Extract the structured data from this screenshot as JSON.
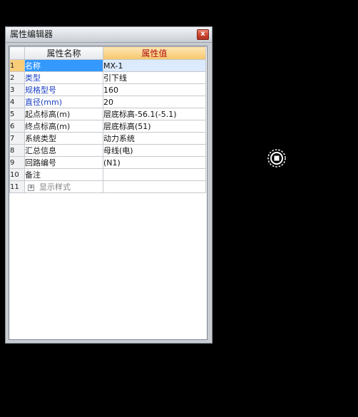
{
  "window": {
    "title": "属性编辑器",
    "close_label": "x"
  },
  "grid": {
    "header_name": "属性名称",
    "header_value": "属性值",
    "rows": [
      {
        "num": "1",
        "name": "名称",
        "value": "MX-1"
      },
      {
        "num": "2",
        "name": "类型",
        "value": "引下线"
      },
      {
        "num": "3",
        "name": "规格型号",
        "value": "160"
      },
      {
        "num": "4",
        "name": "直径(mm)",
        "value": "20"
      },
      {
        "num": "5",
        "name": "起点标高(m)",
        "value": "层底标高-56.1(-5.1)"
      },
      {
        "num": "6",
        "name": "终点标高(m)",
        "value": "层底标高(51)"
      },
      {
        "num": "7",
        "name": "系统类型",
        "value": "动力系统"
      },
      {
        "num": "8",
        "name": "汇总信息",
        "value": "母线(电)"
      },
      {
        "num": "9",
        "name": "回路编号",
        "value": "(N1)"
      },
      {
        "num": "10",
        "name": "备注",
        "value": ""
      },
      {
        "num": "11",
        "name": "显示样式",
        "value": "",
        "expander": "+"
      }
    ]
  },
  "colors": {
    "background": "#000000",
    "selection": "#3399ff",
    "header_value": "#f6c66a",
    "blue_text": "#1a3fc4"
  }
}
